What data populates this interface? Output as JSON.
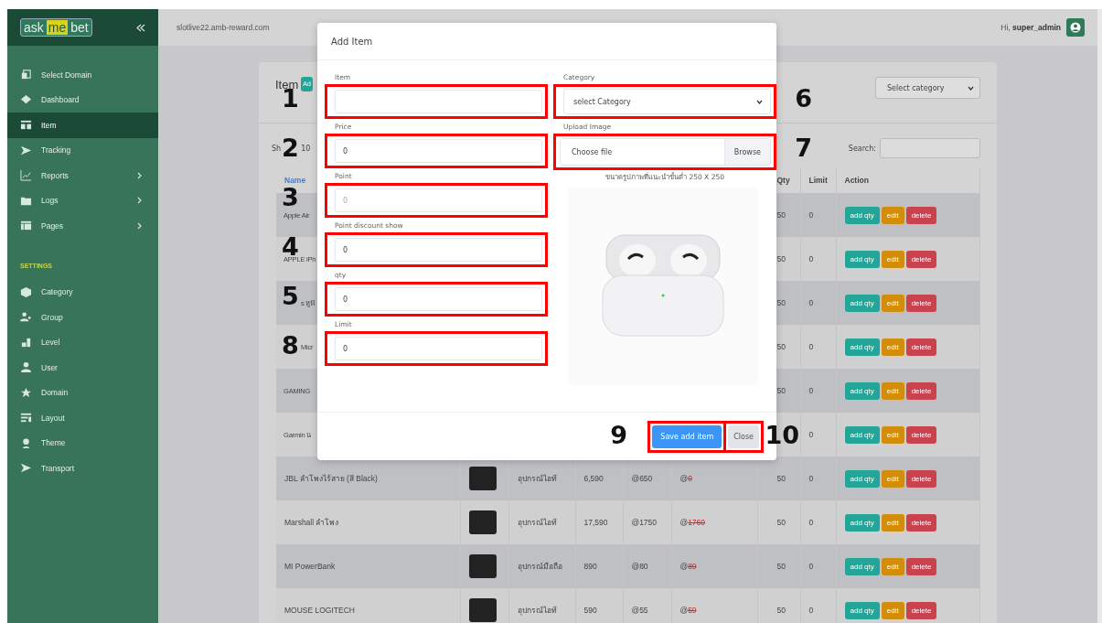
{
  "sidebar": {
    "logo": [
      "ask",
      "me",
      "bet"
    ],
    "items": [
      {
        "label": "Select Domain",
        "selected": false,
        "submenu": false
      },
      {
        "label": "Dashboard",
        "selected": false,
        "submenu": false
      },
      {
        "label": "Item",
        "selected": true,
        "submenu": false
      },
      {
        "label": "Tracking",
        "selected": false,
        "submenu": false
      },
      {
        "label": "Reports",
        "selected": false,
        "submenu": true
      },
      {
        "label": "Logs",
        "selected": false,
        "submenu": true
      },
      {
        "label": "Pages",
        "selected": false,
        "submenu": true
      }
    ],
    "section": "SETTINGS",
    "settings_items": [
      {
        "label": "Category",
        "selected": false
      },
      {
        "label": "Group",
        "selected": false
      },
      {
        "label": "Level",
        "selected": false
      },
      {
        "label": "User",
        "selected": false
      },
      {
        "label": "Domain",
        "selected": false
      },
      {
        "label": "Layout",
        "selected": false
      },
      {
        "label": "Theme",
        "selected": false
      },
      {
        "label": "Transport",
        "selected": false
      }
    ]
  },
  "topbar": {
    "domain": "slotlive22.amb-reward.com",
    "greeting": "Hi,",
    "username": "super_admin"
  },
  "card": {
    "title": "Item",
    "add_button": "Ad",
    "category_filter": "Select category",
    "show_label": "Sh",
    "page_length": "10",
    "search_label": "Search:"
  },
  "table": {
    "header": {
      "name": "Name",
      "name_sorted": true,
      "qty": "Qty",
      "limit": "Limit",
      "action": "Action"
    },
    "rows": [
      {
        "name": "Apple Air",
        "qty": "50",
        "limit": "0",
        "actions": [
          "add qty",
          "edit",
          "delete"
        ]
      },
      {
        "name": "APPLE iPh",
        "qty": "50",
        "limit": "0",
        "actions": [
          "add qty",
          "edit",
          "delete"
        ]
      },
      {
        "name": "s หูฟั",
        "qty": "50",
        "limit": "0",
        "actions": [
          "add qty",
          "edit",
          "delete"
        ]
      },
      {
        "name": "Micr",
        "qty": "50",
        "limit": "0",
        "actions": [
          "add qty",
          "edit",
          "delete"
        ]
      },
      {
        "name": "GAMING",
        "qty": "50",
        "limit": "0",
        "actions": [
          "add qty",
          "edit",
          "delete"
        ]
      },
      {
        "name": "Garmin น",
        "limit": "0",
        "actions": [
          "add qty",
          "edit",
          "delete"
        ]
      },
      {
        "name": "JBL ลำโพงไร้สาย (สี Black)",
        "category": "อุปกรณ์ไอที",
        "price": "6,590",
        "point": "@650",
        "discount_prefix": "@",
        "discount": "0",
        "qty": "50",
        "limit": "0",
        "actions": [
          "add qty",
          "edit",
          "delete"
        ]
      },
      {
        "name": "Marshall ลำโพง",
        "category": "อุปกรณ์ไอที",
        "price": "17,590",
        "point": "@1750",
        "discount_prefix": "@",
        "discount": "1760",
        "qty": "50",
        "limit": "0",
        "actions": [
          "add qty",
          "edit",
          "delete"
        ]
      },
      {
        "name": "MI PowerBank",
        "category": "อุปกรณ์มือถือ",
        "price": "890",
        "point": "@80",
        "discount_prefix": "@",
        "discount": "89",
        "qty": "50",
        "limit": "0",
        "actions": [
          "add qty",
          "edit",
          "delete"
        ]
      },
      {
        "name": "MOUSE LOGITECH",
        "category": "อุปกรณ์ไอที",
        "price": "590",
        "point": "@55",
        "discount_prefix": "@",
        "discount": "59",
        "qty": "50",
        "limit": "0",
        "actions": [
          "add qty",
          "edit",
          "delete"
        ]
      }
    ]
  },
  "modal": {
    "title": "Add Item",
    "left_fields": [
      {
        "label": "Item",
        "marker": "1"
      },
      {
        "label": "Price",
        "value": "0",
        "marker": "2"
      },
      {
        "label": "Point",
        "placeholder": "0",
        "marker": "3"
      },
      {
        "label": "Point discount show",
        "value": "0",
        "marker": "4"
      },
      {
        "label": "qty",
        "value": "0",
        "marker": "5"
      },
      {
        "label": "Limit",
        "value": "0",
        "marker": "8"
      }
    ],
    "category": {
      "label": "Category",
      "value": "select Category",
      "marker": "6"
    },
    "upload": {
      "label": "Upload Image",
      "placeholder": "Choose file",
      "browse": "Browse",
      "hint": "ขนาดรูปภาพที่แนะนำขั้นต่ำ 250 X 250",
      "marker": "7"
    },
    "buttons": [
      {
        "label": "Save add item",
        "kind": "primary",
        "marker": "9"
      },
      {
        "label": "Close",
        "kind": "secondary",
        "marker": "10"
      }
    ]
  }
}
